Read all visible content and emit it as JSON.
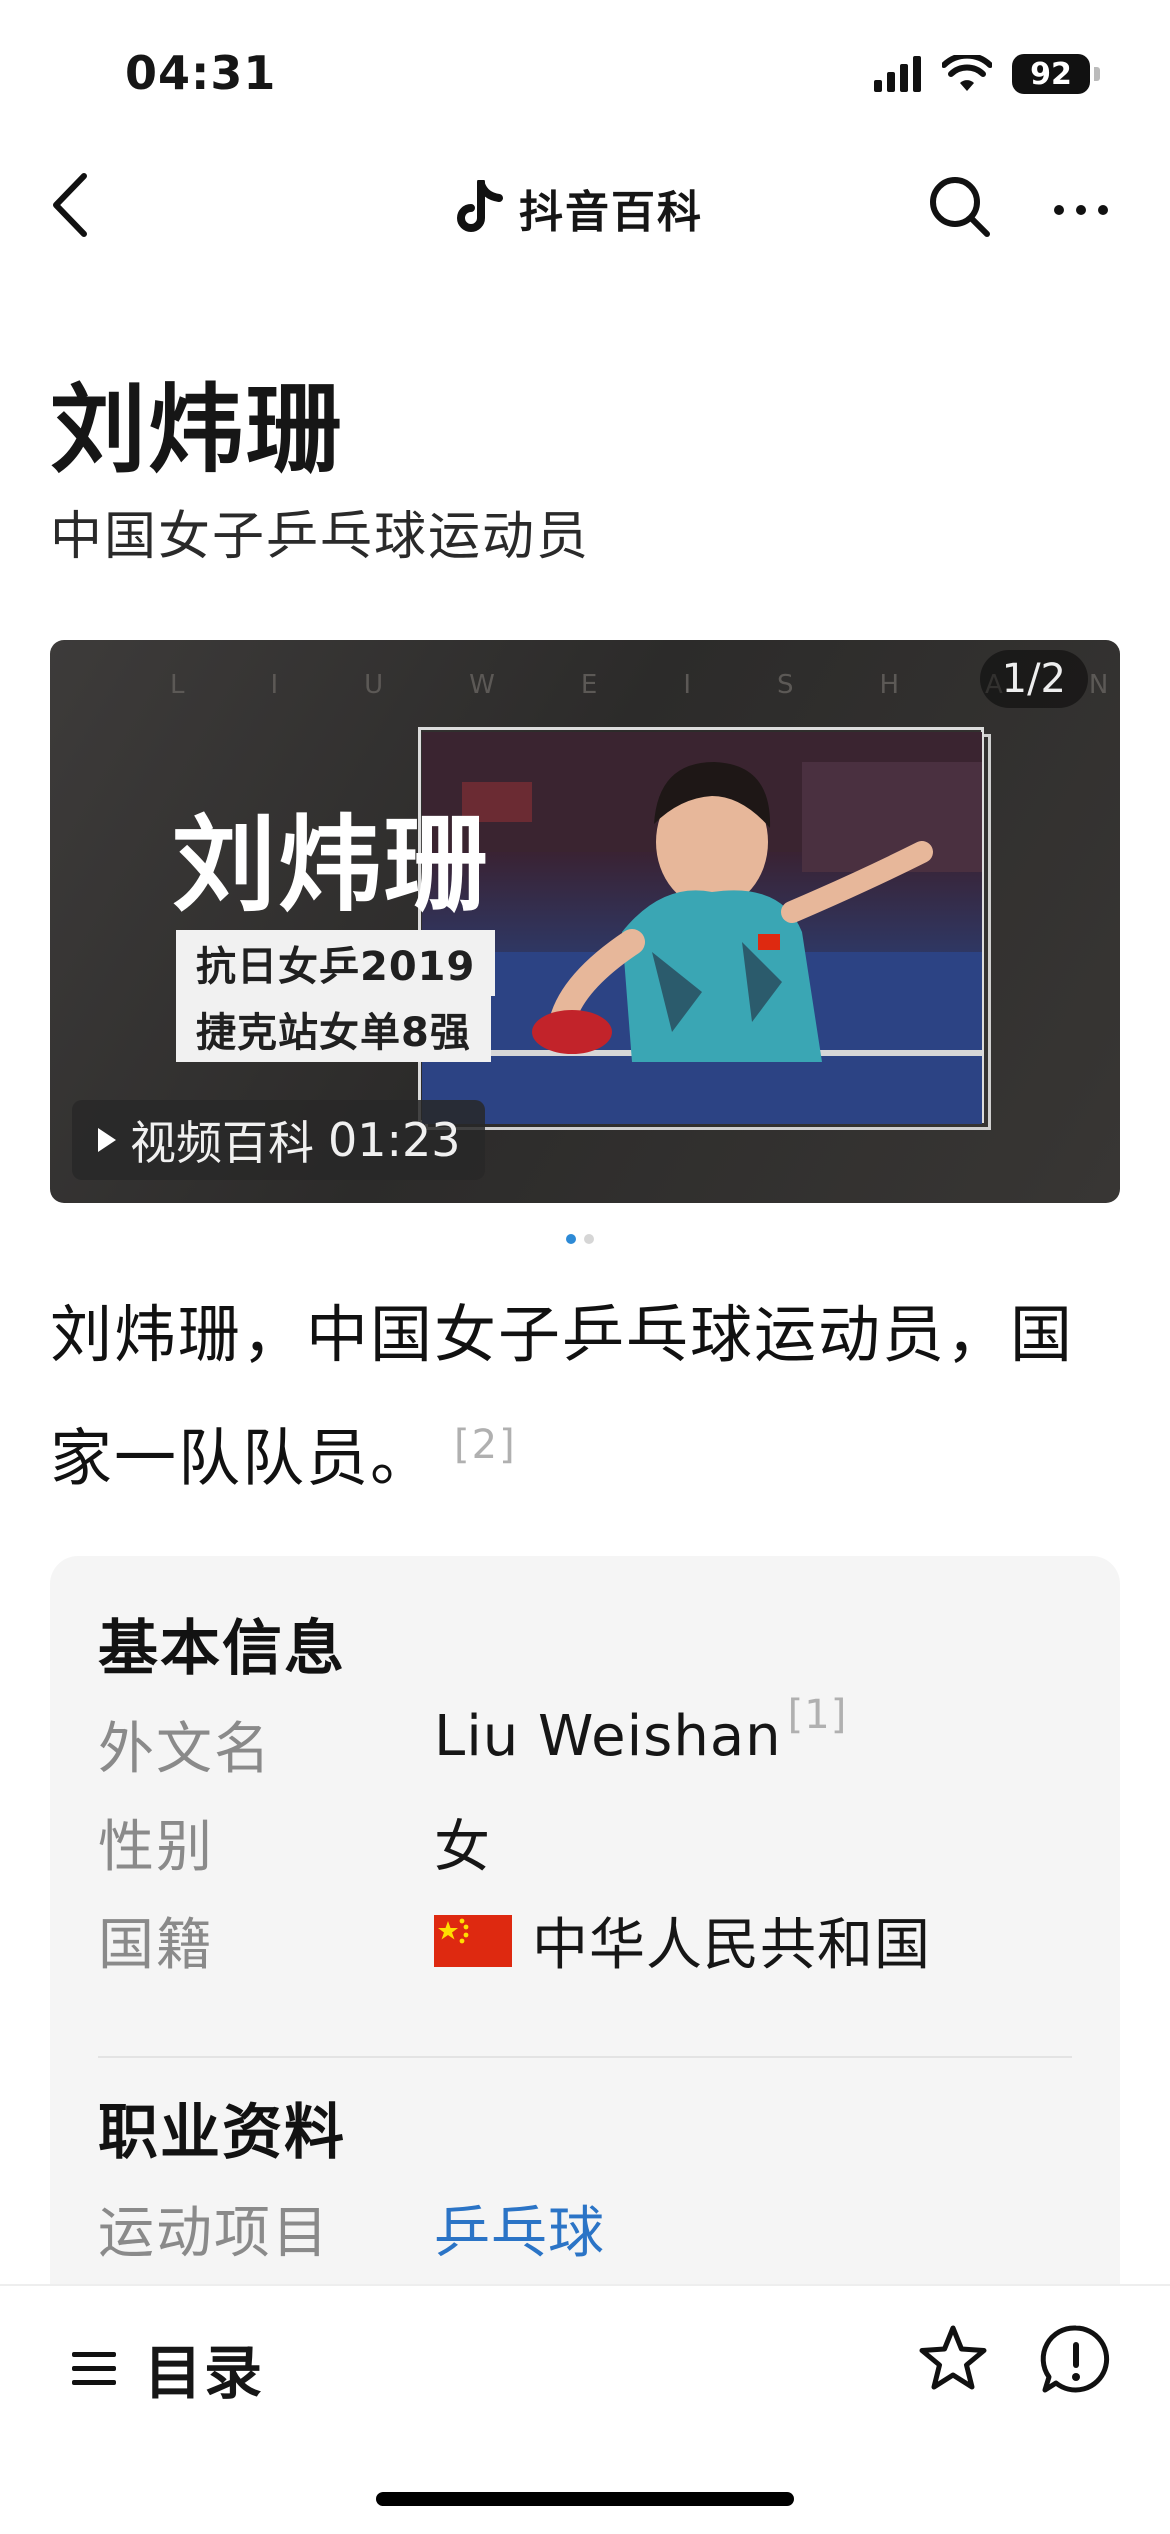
{
  "status_bar": {
    "time": "04:31",
    "battery": "92"
  },
  "nav": {
    "title": "抖音百科"
  },
  "entry": {
    "title": "刘炜珊",
    "subtitle": "中国女子乒乓球运动员"
  },
  "video": {
    "bg_letters": "LIUWEISHAN",
    "counter": "1/2",
    "name": "刘炜珊",
    "tag1": "抗日女乒2019",
    "tag2": "捷克站女单8强",
    "badge_label": "视频百科",
    "duration": "01:23",
    "page_dots": {
      "count": 2,
      "active_index": 0
    }
  },
  "description": {
    "text": "刘炜珊，中国女子乒乓球运动员，国家一队队员。",
    "ref": "[2]"
  },
  "basic_info": {
    "title": "基本信息",
    "rows": [
      {
        "label": "外文名",
        "value": "Liu Weishan",
        "ref": "[1]"
      },
      {
        "label": "性别",
        "value": "女"
      },
      {
        "label": "国籍",
        "value": "中华人民共和国"
      }
    ]
  },
  "career_info": {
    "title": "职业资料",
    "rows": [
      {
        "label": "运动项目",
        "value": "乒乓球"
      }
    ]
  },
  "bottom_bar": {
    "toc_label": "目录"
  },
  "colors": {
    "link": "#2b74c6",
    "accent_dot": "#2d8ad6",
    "flag_red": "#de2910",
    "flag_star": "#ffde00"
  }
}
